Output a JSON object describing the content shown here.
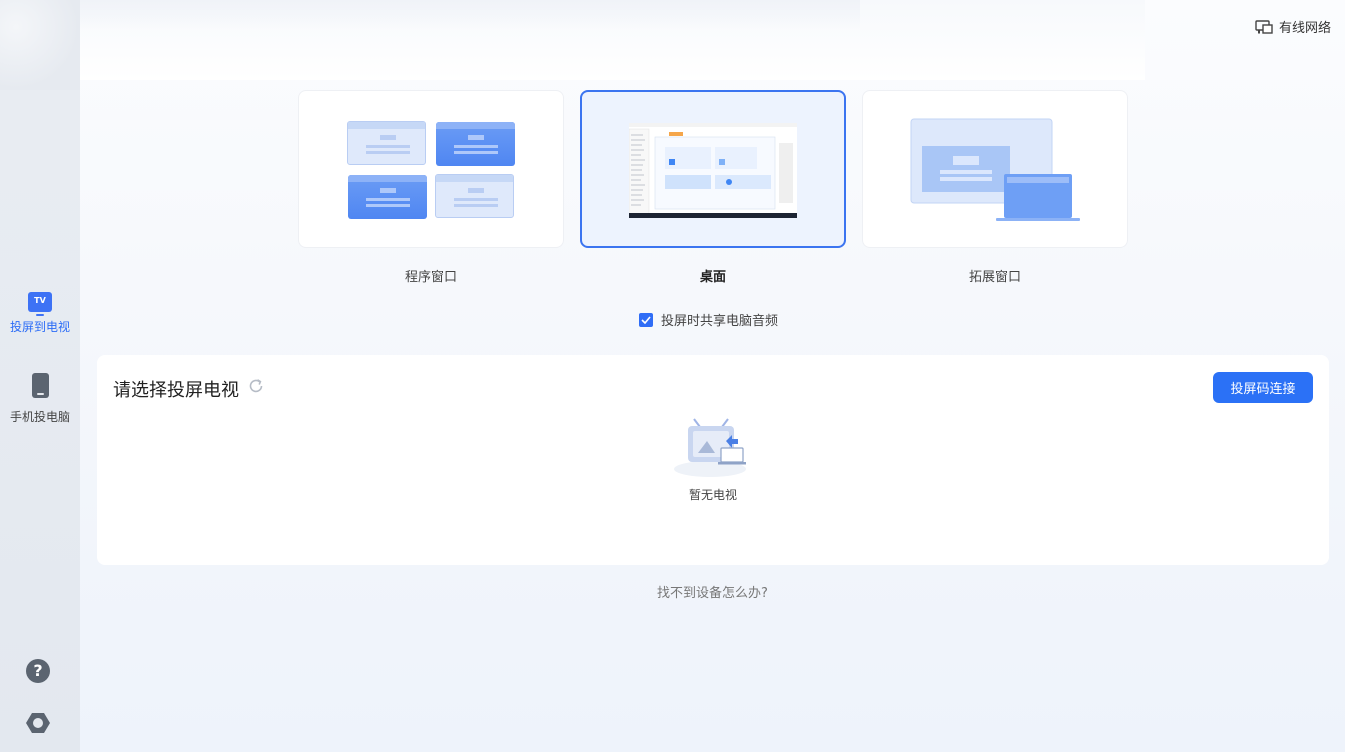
{
  "sidebar": {
    "items": [
      {
        "label": "投屏到电视",
        "icon": "tv-icon",
        "active": true,
        "icon_text": "TV"
      },
      {
        "label": "手机投电脑",
        "icon": "phone-icon",
        "active": false
      }
    ],
    "help_icon_text": "?"
  },
  "header": {
    "network_label": "有线网络"
  },
  "modes": [
    {
      "label": "程序窗口",
      "selected": false
    },
    {
      "label": "桌面",
      "selected": true
    },
    {
      "label": "拓展窗口",
      "selected": false
    }
  ],
  "audio": {
    "label": "投屏时共享电脑音频",
    "checked": true
  },
  "tv_panel": {
    "title": "请选择投屏电视",
    "code_button_label": "投屏码连接",
    "empty_text": "暂无电视"
  },
  "help_link": "找不到设备怎么办?",
  "colors": {
    "accent": "#2b71f6",
    "selected_border": "#3b74f0",
    "sidebar_bg": "#e6eaf0"
  }
}
